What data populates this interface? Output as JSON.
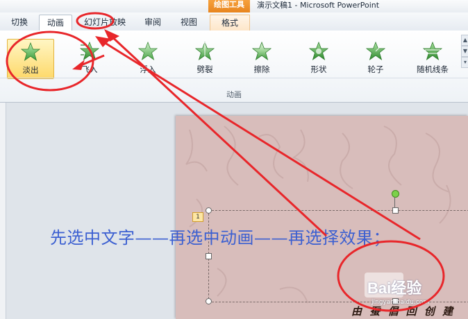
{
  "window": {
    "title": "演示文稿1 - Microsoft PowerPoint",
    "context_tool": "绘图工具"
  },
  "tabs": [
    {
      "label": "切换",
      "active": false
    },
    {
      "label": "动画",
      "active": true
    },
    {
      "label": "幻灯片放映",
      "active": false
    },
    {
      "label": "审阅",
      "active": false
    },
    {
      "label": "视图",
      "active": false
    },
    {
      "label": "格式",
      "active": false,
      "context": true
    }
  ],
  "ribbon": {
    "group_label": "动画",
    "effects": [
      {
        "label": "淡出",
        "icon": "fade-star-icon",
        "selected": true
      },
      {
        "label": "飞入",
        "icon": "fly-in-star-icon",
        "selected": false
      },
      {
        "label": "浮入",
        "icon": "float-in-star-icon",
        "selected": false
      },
      {
        "label": "劈裂",
        "icon": "split-star-icon",
        "selected": false
      },
      {
        "label": "擦除",
        "icon": "wipe-star-icon",
        "selected": false
      },
      {
        "label": "形状",
        "icon": "shape-star-icon",
        "selected": false
      },
      {
        "label": "轮子",
        "icon": "wheel-star-icon",
        "selected": false
      },
      {
        "label": "随机线条",
        "icon": "random-bars-star-icon",
        "selected": false
      }
    ]
  },
  "slide": {
    "animation_order_tag": "1",
    "instruction_text": "先选中文字——再选中动画——再选择效果；",
    "signature": "由 蚕 倡 回 创 建",
    "watermark_brand": "Bai经验",
    "watermark_url": "jingyan.baidu.com"
  },
  "colors": {
    "accent_selected": "#fed96b",
    "instruction_blue": "#3b5fd1",
    "annotation_red": "#e8262a",
    "slide_background": "#d8bdbb"
  }
}
